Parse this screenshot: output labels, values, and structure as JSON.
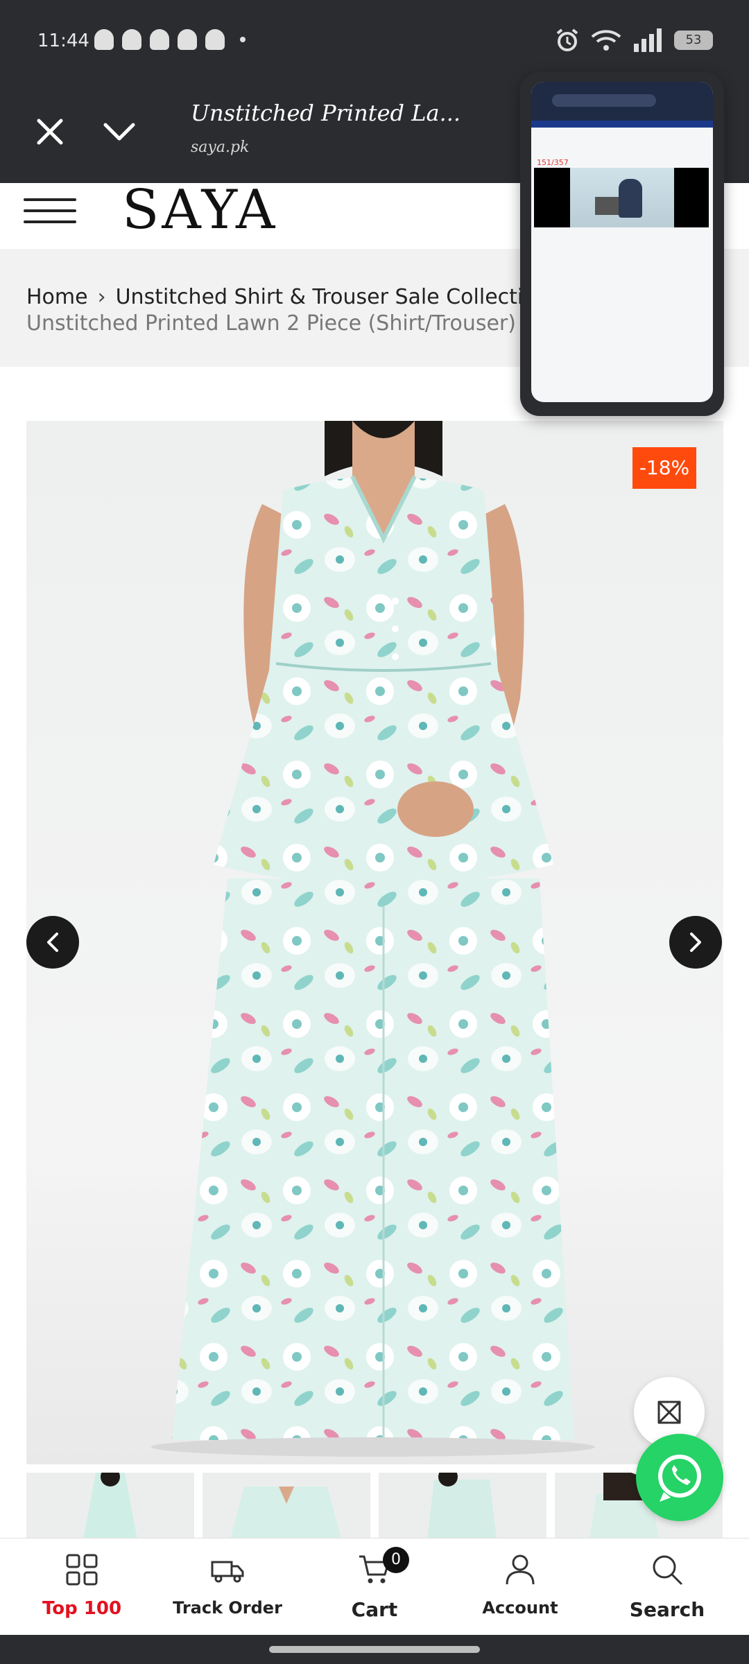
{
  "status_bar": {
    "time": "11:44",
    "battery": "53"
  },
  "custom_tab": {
    "title": "Unstitched Printed La...",
    "domain": "saya.pk"
  },
  "header": {
    "logo": "SAYA"
  },
  "breadcrumb": {
    "home": "Home",
    "category": "Unstitched Shirt & Trouser Sale Collection",
    "current": "Unstitched Printed Lawn 2 Piece (Shirt/Trouser)"
  },
  "floating_preview": {
    "counter": "151/357"
  },
  "product": {
    "discount": "-18%"
  },
  "bottom_nav": {
    "items": [
      {
        "label": "Top 100",
        "color": "#e3101f"
      },
      {
        "label": "Track Order"
      },
      {
        "label": "Cart",
        "badge": "0"
      },
      {
        "label": "Account"
      },
      {
        "label": "Search"
      }
    ]
  },
  "colors": {
    "accent_red": "#e3101f",
    "discount_orange": "#ff4a0d",
    "whatsapp_green": "#25d366",
    "dark_bar": "#2b2c2f"
  }
}
